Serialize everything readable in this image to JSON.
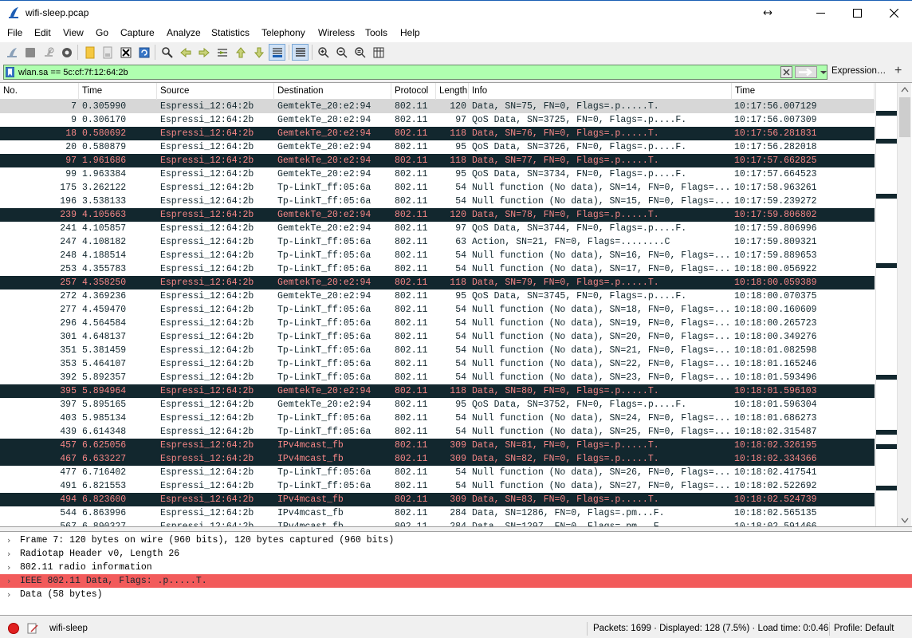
{
  "window": {
    "title": "wifi-sleep.pcap",
    "controls": [
      "resize-icon",
      "minimize-icon",
      "maximize-icon",
      "close-icon"
    ]
  },
  "menu": [
    "File",
    "Edit",
    "View",
    "Go",
    "Capture",
    "Analyze",
    "Statistics",
    "Telephony",
    "Wireless",
    "Tools",
    "Help"
  ],
  "toolbar": {
    "icons": [
      "shark-fin-start-icon",
      "stop-square-icon",
      "restart-capture-icon",
      "capture-options-gear-icon",
      "open-folder-icon",
      "save-file-icon",
      "close-file-icon",
      "reload-file-icon",
      "find-packet-magnifier-icon",
      "go-back-arrow-icon",
      "go-forward-arrow-icon",
      "go-to-packet-icon",
      "go-first-packet-icon",
      "go-last-packet-icon",
      "autoscroll-icon",
      "colorize-list-icon",
      "zoom-in-icon",
      "zoom-out-icon",
      "normal-size-icon",
      "resize-columns-icon"
    ]
  },
  "filter": {
    "value": "wlan.sa == 5c:cf:7f:12:64:2b",
    "expression_label": "Expression…",
    "plus_label": "+",
    "background": "#afffaf"
  },
  "columns": [
    "No.",
    "Time",
    "Source",
    "Destination",
    "Protocol",
    "Length",
    "Info",
    "Time"
  ],
  "colors": {
    "dark_row_bg": "#12272e",
    "dark_row_fg": "#f78787",
    "selected_row_bg": "#d7d7d7",
    "detail_highlight": "#f25b5b"
  },
  "packets": [
    {
      "no": "7",
      "time": "0.305990",
      "source": "Espressi_12:64:2b",
      "destination": "GemtekTe_20:e2:94",
      "protocol": "802.11",
      "length": "120",
      "info": "Data, SN=75, FN=0, Flags=.p.....T.",
      "abs_time": "10:17:56.007129",
      "style": "selected"
    },
    {
      "no": "9",
      "time": "0.306170",
      "source": "Espressi_12:64:2b",
      "destination": "GemtekTe_20:e2:94",
      "protocol": "802.11",
      "length": "97",
      "info": "QoS Data, SN=3725, FN=0, Flags=.p....F.",
      "abs_time": "10:17:56.007309",
      "style": "normal"
    },
    {
      "no": "18",
      "time": "0.580692",
      "source": "Espressi_12:64:2b",
      "destination": "GemtekTe_20:e2:94",
      "protocol": "802.11",
      "length": "118",
      "info": "Data, SN=76, FN=0, Flags=.p.....T.",
      "abs_time": "10:17:56.281831",
      "style": "dark"
    },
    {
      "no": "20",
      "time": "0.580879",
      "source": "Espressi_12:64:2b",
      "destination": "GemtekTe_20:e2:94",
      "protocol": "802.11",
      "length": "95",
      "info": "QoS Data, SN=3726, FN=0, Flags=.p....F.",
      "abs_time": "10:17:56.282018",
      "style": "normal"
    },
    {
      "no": "97",
      "time": "1.961686",
      "source": "Espressi_12:64:2b",
      "destination": "GemtekTe_20:e2:94",
      "protocol": "802.11",
      "length": "118",
      "info": "Data, SN=77, FN=0, Flags=.p.....T.",
      "abs_time": "10:17:57.662825",
      "style": "dark"
    },
    {
      "no": "99",
      "time": "1.963384",
      "source": "Espressi_12:64:2b",
      "destination": "GemtekTe_20:e2:94",
      "protocol": "802.11",
      "length": "95",
      "info": "QoS Data, SN=3734, FN=0, Flags=.p....F.",
      "abs_time": "10:17:57.664523",
      "style": "normal"
    },
    {
      "no": "175",
      "time": "3.262122",
      "source": "Espressi_12:64:2b",
      "destination": "Tp-LinkT_ff:05:6a",
      "protocol": "802.11",
      "length": "54",
      "info": "Null function (No data), SN=14, FN=0, Flags=...",
      "abs_time": "10:17:58.963261",
      "style": "normal"
    },
    {
      "no": "196",
      "time": "3.538133",
      "source": "Espressi_12:64:2b",
      "destination": "Tp-LinkT_ff:05:6a",
      "protocol": "802.11",
      "length": "54",
      "info": "Null function (No data), SN=15, FN=0, Flags=...",
      "abs_time": "10:17:59.239272",
      "style": "normal"
    },
    {
      "no": "239",
      "time": "4.105663",
      "source": "Espressi_12:64:2b",
      "destination": "GemtekTe_20:e2:94",
      "protocol": "802.11",
      "length": "120",
      "info": "Data, SN=78, FN=0, Flags=.p.....T.",
      "abs_time": "10:17:59.806802",
      "style": "dark"
    },
    {
      "no": "241",
      "time": "4.105857",
      "source": "Espressi_12:64:2b",
      "destination": "GemtekTe_20:e2:94",
      "protocol": "802.11",
      "length": "97",
      "info": "QoS Data, SN=3744, FN=0, Flags=.p....F.",
      "abs_time": "10:17:59.806996",
      "style": "normal"
    },
    {
      "no": "247",
      "time": "4.108182",
      "source": "Espressi_12:64:2b",
      "destination": "Tp-LinkT_ff:05:6a",
      "protocol": "802.11",
      "length": "63",
      "info": "Action, SN=21, FN=0, Flags=........C",
      "abs_time": "10:17:59.809321",
      "style": "normal"
    },
    {
      "no": "248",
      "time": "4.188514",
      "source": "Espressi_12:64:2b",
      "destination": "Tp-LinkT_ff:05:6a",
      "protocol": "802.11",
      "length": "54",
      "info": "Null function (No data), SN=16, FN=0, Flags=...",
      "abs_time": "10:17:59.889653",
      "style": "normal"
    },
    {
      "no": "253",
      "time": "4.355783",
      "source": "Espressi_12:64:2b",
      "destination": "Tp-LinkT_ff:05:6a",
      "protocol": "802.11",
      "length": "54",
      "info": "Null function (No data), SN=17, FN=0, Flags=...",
      "abs_time": "10:18:00.056922",
      "style": "normal"
    },
    {
      "no": "257",
      "time": "4.358250",
      "source": "Espressi_12:64:2b",
      "destination": "GemtekTe_20:e2:94",
      "protocol": "802.11",
      "length": "118",
      "info": "Data, SN=79, FN=0, Flags=.p.....T.",
      "abs_time": "10:18:00.059389",
      "style": "dark"
    },
    {
      "no": "272",
      "time": "4.369236",
      "source": "Espressi_12:64:2b",
      "destination": "GemtekTe_20:e2:94",
      "protocol": "802.11",
      "length": "95",
      "info": "QoS Data, SN=3745, FN=0, Flags=.p....F.",
      "abs_time": "10:18:00.070375",
      "style": "normal"
    },
    {
      "no": "277",
      "time": "4.459470",
      "source": "Espressi_12:64:2b",
      "destination": "Tp-LinkT_ff:05:6a",
      "protocol": "802.11",
      "length": "54",
      "info": "Null function (No data), SN=18, FN=0, Flags=...",
      "abs_time": "10:18:00.160609",
      "style": "normal"
    },
    {
      "no": "296",
      "time": "4.564584",
      "source": "Espressi_12:64:2b",
      "destination": "Tp-LinkT_ff:05:6a",
      "protocol": "802.11",
      "length": "54",
      "info": "Null function (No data), SN=19, FN=0, Flags=...",
      "abs_time": "10:18:00.265723",
      "style": "normal"
    },
    {
      "no": "301",
      "time": "4.648137",
      "source": "Espressi_12:64:2b",
      "destination": "Tp-LinkT_ff:05:6a",
      "protocol": "802.11",
      "length": "54",
      "info": "Null function (No data), SN=20, FN=0, Flags=...",
      "abs_time": "10:18:00.349276",
      "style": "normal"
    },
    {
      "no": "351",
      "time": "5.381459",
      "source": "Espressi_12:64:2b",
      "destination": "Tp-LinkT_ff:05:6a",
      "protocol": "802.11",
      "length": "54",
      "info": "Null function (No data), SN=21, FN=0, Flags=...",
      "abs_time": "10:18:01.082598",
      "style": "normal"
    },
    {
      "no": "353",
      "time": "5.464107",
      "source": "Espressi_12:64:2b",
      "destination": "Tp-LinkT_ff:05:6a",
      "protocol": "802.11",
      "length": "54",
      "info": "Null function (No data), SN=22, FN=0, Flags=...",
      "abs_time": "10:18:01.165246",
      "style": "normal"
    },
    {
      "no": "392",
      "time": "5.892357",
      "source": "Espressi_12:64:2b",
      "destination": "Tp-LinkT_ff:05:6a",
      "protocol": "802.11",
      "length": "54",
      "info": "Null function (No data), SN=23, FN=0, Flags=...",
      "abs_time": "10:18:01.593496",
      "style": "normal"
    },
    {
      "no": "395",
      "time": "5.894964",
      "source": "Espressi_12:64:2b",
      "destination": "GemtekTe_20:e2:94",
      "protocol": "802.11",
      "length": "118",
      "info": "Data, SN=80, FN=0, Flags=.p.....T.",
      "abs_time": "10:18:01.596103",
      "style": "dark"
    },
    {
      "no": "397",
      "time": "5.895165",
      "source": "Espressi_12:64:2b",
      "destination": "GemtekTe_20:e2:94",
      "protocol": "802.11",
      "length": "95",
      "info": "QoS Data, SN=3752, FN=0, Flags=.p....F.",
      "abs_time": "10:18:01.596304",
      "style": "normal"
    },
    {
      "no": "403",
      "time": "5.985134",
      "source": "Espressi_12:64:2b",
      "destination": "Tp-LinkT_ff:05:6a",
      "protocol": "802.11",
      "length": "54",
      "info": "Null function (No data), SN=24, FN=0, Flags=...",
      "abs_time": "10:18:01.686273",
      "style": "normal"
    },
    {
      "no": "439",
      "time": "6.614348",
      "source": "Espressi_12:64:2b",
      "destination": "Tp-LinkT_ff:05:6a",
      "protocol": "802.11",
      "length": "54",
      "info": "Null function (No data), SN=25, FN=0, Flags=...",
      "abs_time": "10:18:02.315487",
      "style": "normal"
    },
    {
      "no": "457",
      "time": "6.625056",
      "source": "Espressi_12:64:2b",
      "destination": "IPv4mcast_fb",
      "protocol": "802.11",
      "length": "309",
      "info": "Data, SN=81, FN=0, Flags=.p.....T.",
      "abs_time": "10:18:02.326195",
      "style": "dark"
    },
    {
      "no": "467",
      "time": "6.633227",
      "source": "Espressi_12:64:2b",
      "destination": "IPv4mcast_fb",
      "protocol": "802.11",
      "length": "309",
      "info": "Data, SN=82, FN=0, Flags=.p.....T.",
      "abs_time": "10:18:02.334366",
      "style": "dark"
    },
    {
      "no": "477",
      "time": "6.716402",
      "source": "Espressi_12:64:2b",
      "destination": "Tp-LinkT_ff:05:6a",
      "protocol": "802.11",
      "length": "54",
      "info": "Null function (No data), SN=26, FN=0, Flags=...",
      "abs_time": "10:18:02.417541",
      "style": "normal"
    },
    {
      "no": "491",
      "time": "6.821553",
      "source": "Espressi_12:64:2b",
      "destination": "Tp-LinkT_ff:05:6a",
      "protocol": "802.11",
      "length": "54",
      "info": "Null function (No data), SN=27, FN=0, Flags=...",
      "abs_time": "10:18:02.522692",
      "style": "normal"
    },
    {
      "no": "494",
      "time": "6.823600",
      "source": "Espressi_12:64:2b",
      "destination": "IPv4mcast_fb",
      "protocol": "802.11",
      "length": "309",
      "info": "Data, SN=83, FN=0, Flags=.p.....T.",
      "abs_time": "10:18:02.524739",
      "style": "dark"
    },
    {
      "no": "544",
      "time": "6.863996",
      "source": "Espressi_12:64:2b",
      "destination": "IPv4mcast_fb",
      "protocol": "802.11",
      "length": "284",
      "info": "Data, SN=1286, FN=0, Flags=.pm...F.",
      "abs_time": "10:18:02.565135",
      "style": "normal"
    },
    {
      "no": "567",
      "time": "6.890327",
      "source": "Espressi_12:64:2b",
      "destination": "IPv4mcast_fb",
      "protocol": "802.11",
      "length": "284",
      "info": "Data, SN=1297, FN=0, Flags=.pm...F.",
      "abs_time": "10:18:02.591466",
      "style": "normal"
    }
  ],
  "details": [
    {
      "label": "Frame 7: 120 bytes on wire (960 bits), 120 bytes captured (960 bits)",
      "highlight": false
    },
    {
      "label": "Radiotap Header v0, Length 26",
      "highlight": false
    },
    {
      "label": "802.11 radio information",
      "highlight": false
    },
    {
      "label": "IEEE 802.11 Data, Flags: .p.....T.",
      "highlight": true
    },
    {
      "label": "Data (58 bytes)",
      "highlight": false
    }
  ],
  "status": {
    "file": "wifi-sleep",
    "packets": "Packets: 1699 · Displayed: 128 (7.5%) · Load time: 0:0.46",
    "profile": "Profile: Default"
  }
}
